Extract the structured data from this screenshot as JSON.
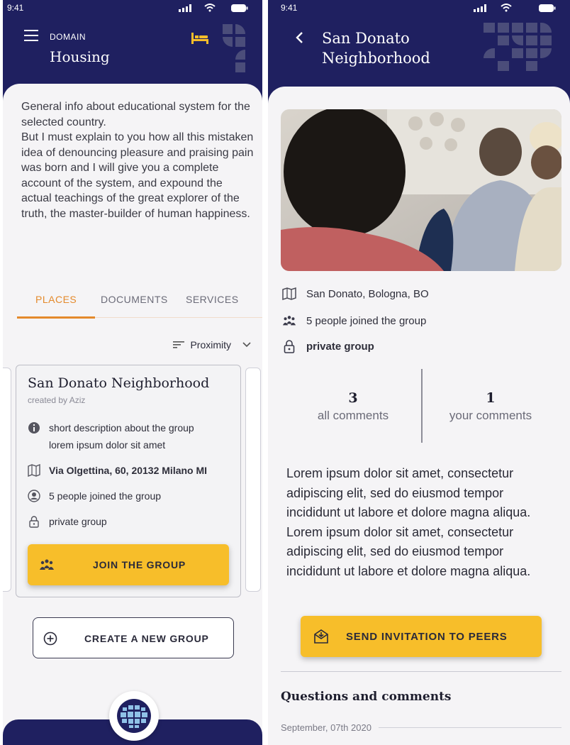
{
  "left": {
    "status": {
      "time": "9:41"
    },
    "header": {
      "domain_label": "DOMAIN",
      "title": "Housing"
    },
    "intro": "General info about educational system for the selected country.\nBut I must explain to you how all this mistaken idea of denouncing pleasure and praising pain was born and I will give you a complete account of the system, and expound the actual teachings of the great explorer of the truth, the master-builder of human happiness.",
    "tabs": [
      {
        "label": "PLACES",
        "active": true
      },
      {
        "label": "DOCUMENTS",
        "active": false
      },
      {
        "label": "SERVICES",
        "active": false
      }
    ],
    "sort": {
      "label": "Proximity"
    },
    "card": {
      "title": "San Donato Neighborhood",
      "creator": "created by Aziz",
      "description_line1": "short description about the group",
      "description_line2": "lorem ipsum dolor sit amet",
      "address": "Via Olgettina, 60, 20132 Milano MI",
      "members": "5 people joined the group",
      "privacy": "private group",
      "join_label": "JOIN THE GROUP"
    },
    "create_label": "CREATE A NEW GROUP"
  },
  "right": {
    "status": {
      "time": "9:41"
    },
    "header": {
      "title_line1": "San Donato",
      "title_line2": "Neighborhood"
    },
    "location": "San Donato, Bologna, BO",
    "members": "5 people joined the group",
    "privacy": "private group",
    "stats": [
      {
        "value": "3",
        "label": "all comments"
      },
      {
        "value": "1",
        "label": "your comments"
      }
    ],
    "body": "Lorem ipsum dolor sit amet, consectetur adipiscing elit, sed do eiusmod tempor incididunt ut labore et dolore magna aliqua. Lorem ipsum dolor sit amet, consectetur adipiscing elit, sed do eiusmod tempor incididunt ut labore et dolore magna aliqua.",
    "invite_label": "SEND INVITATION TO PEERS",
    "questions_title": "Questions and comments",
    "date": "September, 07th 2020"
  },
  "colors": {
    "navy": "#1f2060",
    "accent": "#f7be2a",
    "tab_active": "#e48a2c",
    "bed_icon": "#f7be2a"
  },
  "icons": [
    "menu-icon",
    "bed-icon",
    "back-icon",
    "info-icon",
    "map-icon",
    "person-icon",
    "lock-icon",
    "group-icon",
    "plus-circle-icon",
    "invite-icon",
    "globe-icon",
    "chevron-down-icon",
    "sort-icon"
  ]
}
